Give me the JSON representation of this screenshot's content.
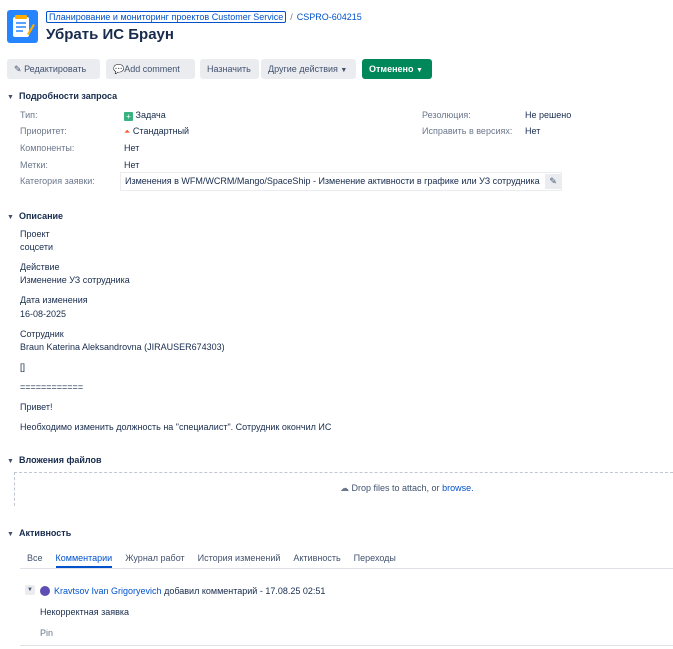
{
  "header": {
    "project_link": "Планирование и мониторинг проектов Customer Service",
    "separator": "/",
    "issue_key": "CSPRO-604215",
    "title": "Убрать ИС Браун"
  },
  "toolbar": {
    "edit": "Редактировать",
    "comment": "Add comment",
    "assign": "Назначить",
    "more": "Другие действия",
    "status": "Отменено"
  },
  "details": {
    "heading": "Подробности запроса",
    "type_label": "Тип:",
    "type_value": "Задача",
    "priority_label": "Приоритет:",
    "priority_value": "Стандартный",
    "components_label": "Компоненты:",
    "components_value": "Нет",
    "labels_label": "Метки:",
    "labels_value": "Нет",
    "category_label": "Категория заявки:",
    "category_value": "Изменения в WFM/WCRM/Mango/SpaceShip - Изменение активности в графике или УЗ сотрудника",
    "resolution_label": "Резолюция:",
    "resolution_value": "Не решено",
    "fix_label": "Исправить в версиях:",
    "fix_value": "Нет"
  },
  "description": {
    "heading": "Описание",
    "l1": "Проект",
    "l2": "соцсети",
    "l3": "Действие",
    "l4": "Изменение УЗ сотрудника",
    "l5": "Дата изменения",
    "l6": "16-08-2025",
    "l7": "Сотрудник",
    "l8": "Braun Katerina Aleksandrovna (JIRAUSER674303)",
    "l9": "[]",
    "l10": "============",
    "l11": "Привет!",
    "l12": "Необходимо изменить должность на \"специалист\". Сотрудник окончил ИС"
  },
  "attachments": {
    "heading": "Вложения файлов",
    "drop_text": "Drop files to attach, or",
    "browse": "browse."
  },
  "activity": {
    "heading": "Активность",
    "tabs": [
      "Все",
      "Комментарии",
      "Журнал работ",
      "История изменений",
      "Активность",
      "Переходы"
    ],
    "active_tab": 1,
    "comment_author": "Kravtsov Ivan Grigoryevich",
    "comment_meta": "добавил комментарий - 17.08.25 02:51",
    "comment_body": "Некорректная заявка",
    "pin": "Pin"
  },
  "colors": {
    "accent": "#0052cc",
    "status_green": "#00875a",
    "type_green": "#36b37e",
    "priority_orange": "#ff5630"
  }
}
